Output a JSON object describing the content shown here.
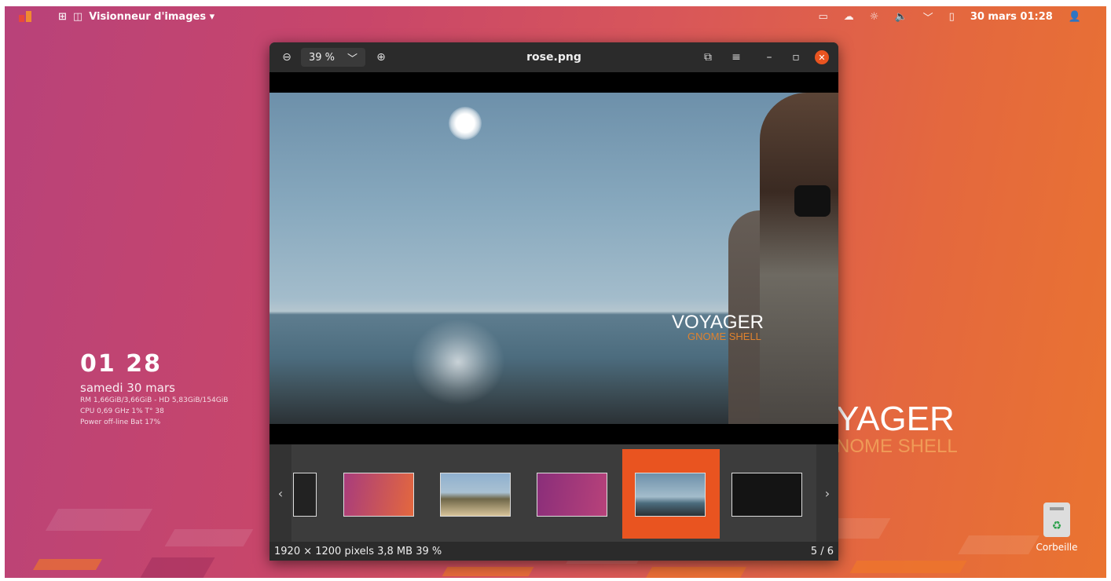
{
  "topbar": {
    "app_menu_label": "Visionneur d'images ▾",
    "datetime": "30 mars 01:28",
    "icons": [
      "activities-grid-icon",
      "image-app-icon",
      "terminal-icon",
      "weather-icon",
      "brightness-icon",
      "volume-icon",
      "network-icon",
      "battery-icon",
      "user-icon"
    ]
  },
  "window": {
    "title": "rose.png",
    "zoom_value": "39 %",
    "controls": [
      "zoom-out",
      "zoom-dropdown",
      "zoom-in",
      "fullscreen",
      "menu",
      "minimize",
      "maximize",
      "close"
    ]
  },
  "image_overlay": {
    "brand": "VOYAGER",
    "sub": "GNOME SHELL"
  },
  "gallery": {
    "prev": "‹",
    "next": "›",
    "thumbnails": [
      {
        "desc": "dark",
        "color": "#222222"
      },
      {
        "desc": "gradient-orange-pink",
        "color": "#d85a5a"
      },
      {
        "desc": "beach",
        "color": "#8aa6b6"
      },
      {
        "desc": "purple",
        "color": "#9b3a7a"
      },
      {
        "desc": "sea-selected",
        "color": "#6b8ea6"
      },
      {
        "desc": "black",
        "color": "#141414"
      }
    ],
    "selected_index": 4
  },
  "statusbar": {
    "info": "1920 × 1200 pixels 3,8 MB 39 %",
    "position": "5 / 6"
  },
  "conky": {
    "time": "01 28",
    "date": "samedi 30 mars",
    "line1": "RM 1,66GiB/3,66GiB - HD 5,83GiB/154GiB",
    "line2": "CPU 0,69 GHz 1% T° 38",
    "line3": "Power off-line Bat 17%"
  },
  "desktop_brand": {
    "main": "YAGER",
    "sub": "NOME SHELL"
  },
  "trash": {
    "label": "Corbeille"
  },
  "colors": {
    "accent": "#e95420",
    "window_bg": "#2d2d2d",
    "header_bg": "#2b2b2b"
  }
}
